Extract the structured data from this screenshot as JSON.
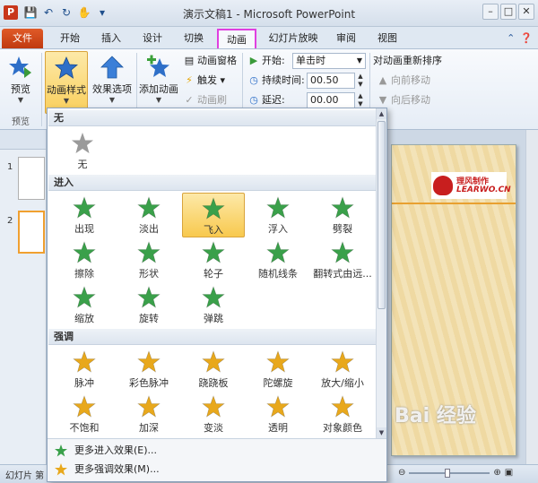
{
  "titlebar": {
    "app_logo": "P",
    "title": "演示文稿1 - Microsoft PowerPoint",
    "qat_icons": [
      "save-icon",
      "undo-icon",
      "redo-icon",
      "touch-icon",
      "customize-icon"
    ],
    "window_controls": [
      "minimize-icon",
      "maximize-icon",
      "close-icon"
    ]
  },
  "tabs": {
    "file": "文件",
    "items": [
      "开始",
      "插入",
      "设计",
      "切换",
      "动画",
      "幻灯片放映",
      "审阅",
      "视图"
    ],
    "active": "动画"
  },
  "ribbon": {
    "preview": "预览",
    "preview_group": "预览",
    "animation_styles": "动画样式",
    "effect_options": "效果选项",
    "add_animation": "添加动画",
    "animation_pane": "动画窗格",
    "trigger": "触发",
    "animation_painter": "动画刷",
    "start_label": "开始:",
    "start_value": "单击时",
    "duration_label": "持续时间:",
    "duration_value": "00.50",
    "delay_label": "延迟:",
    "delay_value": "00.00",
    "reorder_title": "对动画重新排序",
    "move_earlier": "向前移动",
    "move_later": "向后移动"
  },
  "slides": [
    {
      "num": "1"
    },
    {
      "num": "2"
    }
  ],
  "slide_logo": {
    "line1": "理风制作",
    "line2": "LEARWO.CN"
  },
  "gallery": {
    "sections": {
      "none": "无",
      "entrance": "进入",
      "emphasis": "强调"
    },
    "none_item": "无",
    "entrance": [
      "出现",
      "淡出",
      "飞入",
      "浮入",
      "劈裂",
      "擦除",
      "形状",
      "轮子",
      "随机线条",
      "翻转式由远...",
      "缩放",
      "旋转",
      "弹跳"
    ],
    "selected": "飞入",
    "emphasis": [
      "脉冲",
      "彩色脉冲",
      "跷跷板",
      "陀螺旋",
      "放大/缩小",
      "不饱和",
      "加深",
      "变淡",
      "透明",
      "对象颜色"
    ],
    "more_entrance": "更多进入效果(E)...",
    "more_emphasis": "更多强调效果(M)..."
  },
  "statusbar": {
    "left": "幻灯片 第"
  },
  "watermark": "Bai 经验",
  "colors": {
    "entrance_star": "#3aa04a",
    "emphasis_star": "#e8a81c",
    "none_star": "#9a9a9a",
    "selected_bg": "#f8c94e",
    "file_tab": "#d04a1c",
    "active_tab_outline": "#e040e0"
  }
}
